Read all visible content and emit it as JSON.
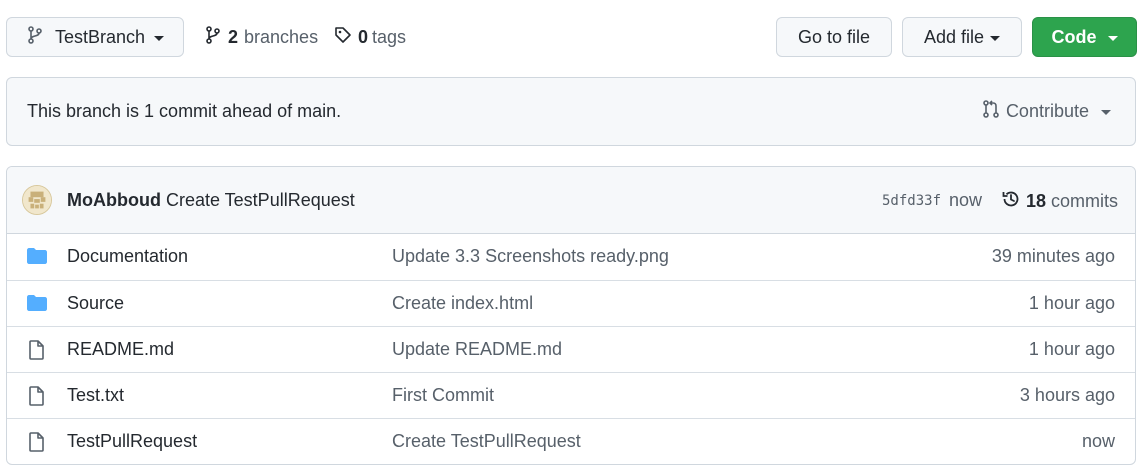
{
  "toolbar": {
    "branch_name": "TestBranch",
    "branches_count": "2",
    "branches_label": "branches",
    "tags_count": "0",
    "tags_label": "tags",
    "go_to_file": "Go to file",
    "add_file": "Add file",
    "code": "Code"
  },
  "branch_status": {
    "text": "This branch is 1 commit ahead of main.",
    "contribute": "Contribute"
  },
  "latest_commit": {
    "author": "MoAbboud",
    "message": "Create TestPullRequest",
    "sha": "5dfd33f",
    "time": "now",
    "commits_count": "18",
    "commits_label": "commits"
  },
  "files": [
    {
      "type": "folder",
      "icon": "folder-icon",
      "name": "Documentation",
      "message": "Update 3.3 Screenshots ready.png",
      "age": "39 minutes ago"
    },
    {
      "type": "folder",
      "icon": "folder-icon",
      "name": "Source",
      "message": "Create index.html",
      "age": "1 hour ago"
    },
    {
      "type": "file",
      "icon": "file-icon",
      "name": "README.md",
      "message": "Update README.md",
      "age": "1 hour ago"
    },
    {
      "type": "file",
      "icon": "file-icon",
      "name": "Test.txt",
      "message": "First Commit",
      "age": "3 hours ago"
    },
    {
      "type": "file",
      "icon": "file-icon",
      "name": "TestPullRequest",
      "message": "Create TestPullRequest",
      "age": "now"
    }
  ],
  "colors": {
    "accent_green": "#2da44e",
    "folder_blue": "#54aeff",
    "border": "#d0d7de",
    "muted_text": "#57606a"
  }
}
